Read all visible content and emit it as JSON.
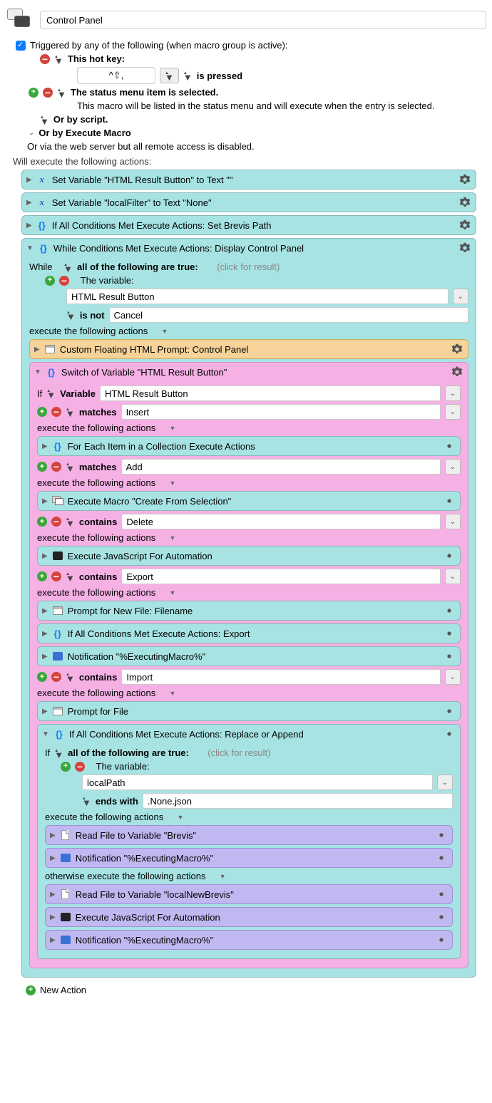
{
  "title": "Control Panel",
  "triggered": "Triggered by any of the following (when macro group is active):",
  "hotkey": {
    "label": "This hot key:",
    "combo": "^⇧,",
    "state": "is pressed"
  },
  "statusMenu": {
    "label": "The status menu item is selected.",
    "desc": "This macro will be listed in the status menu and will execute when the entry is selected."
  },
  "byScript": "Or by script.",
  "byExec": "Or by Execute Macro",
  "byWeb": "Or via the web server but all remote access is disabled.",
  "willExec": "Will execute the following actions:",
  "a1": "Set Variable \"HTML Result Button\" to Text \"\"",
  "a2": "Set Variable \"localFilter\" to Text \"None\"",
  "a3": "If All Conditions Met Execute Actions: Set Brevis Path",
  "while": {
    "title": "While Conditions Met Execute Actions: Display Control Panel",
    "while": "While",
    "allTrue": "all of the following are true:",
    "click": "(click for result)",
    "varLabel": "The variable:",
    "varName": "HTML Result Button",
    "op": "is not",
    "val": "Cancel",
    "execLabel": "execute the following actions"
  },
  "prompt": "Custom Floating HTML Prompt: Control Panel",
  "switch": {
    "title": "Switch of Variable \"HTML Result Button\"",
    "if": "If",
    "var": "Variable",
    "varVal": "HTML Result Button",
    "execLabel": "execute the following actions"
  },
  "cases": {
    "insert": {
      "op": "matches",
      "val": "Insert",
      "action": "For Each Item in a Collection Execute Actions"
    },
    "add": {
      "op": "matches",
      "val": "Add",
      "action": "Execute Macro \"Create From Selection\""
    },
    "delete": {
      "op": "contains",
      "val": "Delete",
      "action": "Execute JavaScript For Automation"
    },
    "export": {
      "op": "contains",
      "val": "Export",
      "a1": "Prompt for New File: Filename",
      "a2": "If All Conditions Met Execute Actions: Export",
      "a3": "Notification \"%ExecutingMacro%\""
    },
    "import": {
      "op": "contains",
      "val": "Import",
      "a1": "Prompt for File",
      "ifTitle": "If All Conditions Met Execute Actions: Replace or Append",
      "if": "If",
      "allTrue": "all of the following are true:",
      "click": "(click for result)",
      "varLabel": "The variable:",
      "varName": "localPath",
      "endsOp": "ends with",
      "endsVal": ".None.json",
      "execLabel": "execute the following actions",
      "thenA1": "Read File to Variable \"Brevis\"",
      "thenA2": "Notification \"%ExecutingMacro%\"",
      "otherwise": "otherwise execute the following actions",
      "elseA1": "Read File to Variable \"localNewBrevis\"",
      "elseA2": "Execute JavaScript For Automation",
      "elseA3": "Notification \"%ExecutingMacro%\""
    }
  },
  "newAction": "New Action"
}
